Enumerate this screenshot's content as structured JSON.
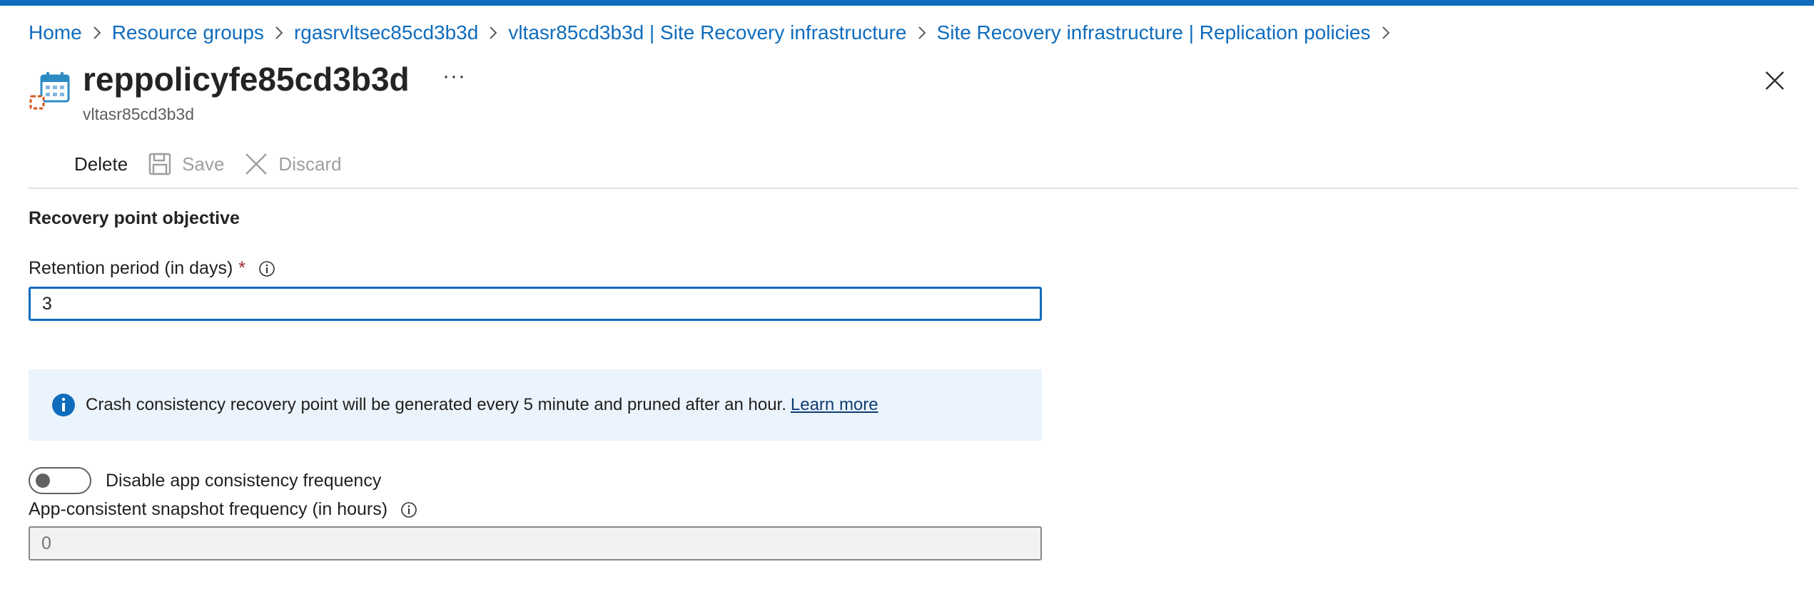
{
  "breadcrumb": {
    "items": [
      "Home",
      "Resource groups",
      "rgasrvltsec85cd3b3d",
      "vltasr85cd3b3d | Site Recovery infrastructure",
      "Site Recovery infrastructure | Replication policies"
    ]
  },
  "header": {
    "title": "reppolicyfe85cd3b3d",
    "subtitle": "vltasr85cd3b3d",
    "more_label": "···",
    "icon": "replication-policy-icon"
  },
  "toolbar": {
    "delete_label": "Delete",
    "save_label": "Save",
    "discard_label": "Discard"
  },
  "form": {
    "section_title": "Recovery point objective",
    "retention_label": "Retention period (in days)",
    "required_marker": "*",
    "retention_value": "3",
    "banner_text": "Crash consistency recovery point will be generated every 5 minute and pruned after an hour.",
    "banner_link": "Learn more",
    "toggle_label": "Disable app consistency frequency",
    "toggle_on": false,
    "snapshot_label": "App-consistent snapshot frequency (in hours)",
    "snapshot_placeholder": "0"
  },
  "colors": {
    "accent": "#0f6cbd",
    "banner_bg": "#ebf3fc",
    "required": "#a4262c"
  }
}
